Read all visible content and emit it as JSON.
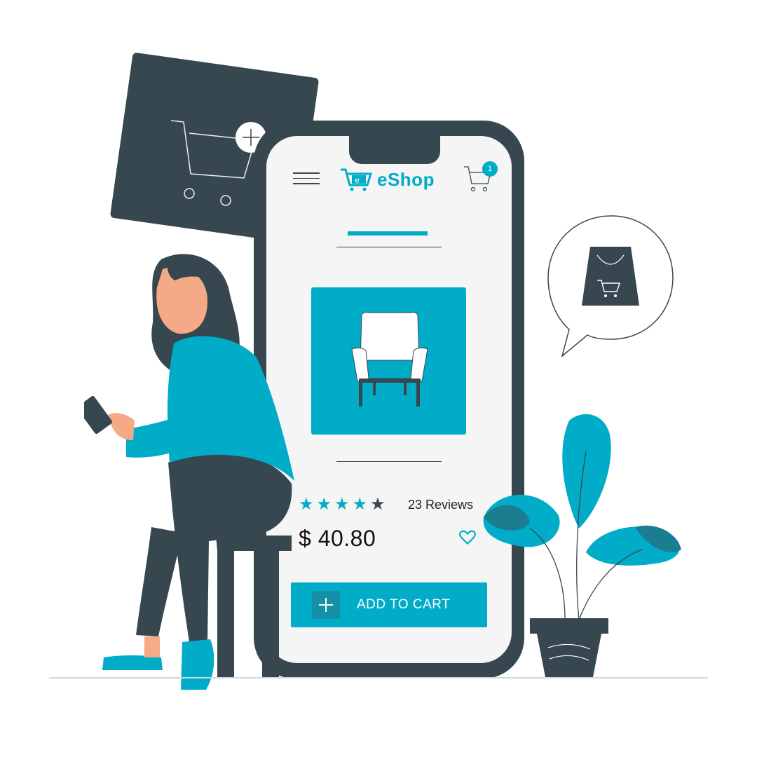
{
  "header": {
    "brand_name": "eShop",
    "cart_count": "1",
    "icons": [
      "menu-icon",
      "cart-logo-icon",
      "cart-icon"
    ]
  },
  "product": {
    "rating": 4,
    "rating_max": 5,
    "reviews_label": "23 Reviews",
    "price": "$ 40.80",
    "image_icon": "armchair-icon",
    "favorite_icon": "heart-icon"
  },
  "actions": {
    "add_to_cart_label": "ADD TO CART",
    "add_icon": "plus-icon"
  },
  "colors": {
    "accent": "#00acc8",
    "dark": "#37474f",
    "screen_bg": "#f5f5f5"
  }
}
